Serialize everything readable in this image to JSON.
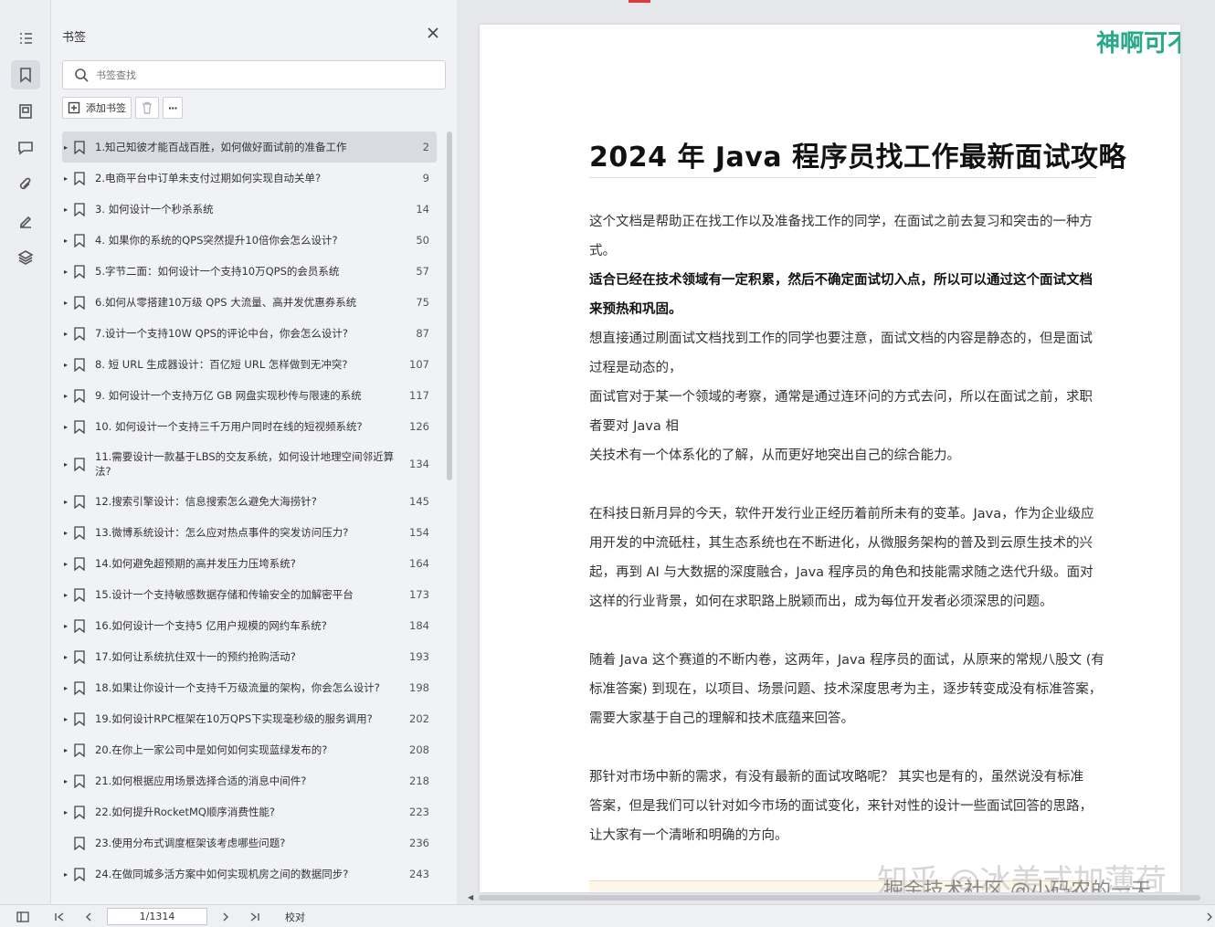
{
  "rail": {
    "icons": [
      "outline-icon",
      "bookmark-icon",
      "thumbnail-icon",
      "comment-icon",
      "attachment-icon",
      "signature-icon",
      "layers-icon"
    ]
  },
  "panel": {
    "title": "书签",
    "search_placeholder": "书签查找",
    "add_bookmark_label": "添加书签",
    "more_label": "···"
  },
  "bookmarks": [
    {
      "text": "1.知己知彼才能百战百胜，如何做好面试前的准备工作",
      "page": "2",
      "expandable": true,
      "selected": true
    },
    {
      "text": "2.电商平台中订单未支付过期如何实现自动关单?",
      "page": "9",
      "expandable": true
    },
    {
      "text": "3. 如何设计一个秒杀系统",
      "page": "14",
      "expandable": true
    },
    {
      "text": "4. 如果你的系统的QPS突然提升10倍你会怎么设计?",
      "page": "50",
      "expandable": true
    },
    {
      "text": "5.字节二面：如何设计一个支持10万QPS的会员系统",
      "page": "57",
      "expandable": true
    },
    {
      "text": "6.如何从零搭建10万级 QPS 大流量、高并发优惠券系统",
      "page": "75",
      "expandable": true
    },
    {
      "text": "7.设计一个支持10W QPS的评论中台，你会怎么设计?",
      "page": "87",
      "expandable": true
    },
    {
      "text": "8. 短 URL 生成器设计：百亿短 URL 怎样做到无冲突?",
      "page": "107",
      "expandable": true
    },
    {
      "text": "9. 如何设计一个支持万亿 GB 网盘实现秒传与限速的系统",
      "page": "117",
      "expandable": true
    },
    {
      "text": "10. 如何设计一个支持三千万用户同时在线的短视频系统?",
      "page": "126",
      "expandable": true
    },
    {
      "text": "11.需要设计一款基于LBS的交友系统，如何设计地理空间邻近算法?",
      "page": "134",
      "expandable": true,
      "twoLine": true
    },
    {
      "text": "12.搜索引擎设计：信息搜索怎么避免大海捞针?",
      "page": "145",
      "expandable": true
    },
    {
      "text": "13.微博系统设计：怎么应对热点事件的突发访问压力?",
      "page": "154",
      "expandable": true
    },
    {
      "text": "14.如何避免超预期的高并发压力压垮系统?",
      "page": "164",
      "expandable": true
    },
    {
      "text": "15.设计一个支持敏感数据存储和传输安全的加解密平台",
      "page": "173",
      "expandable": true
    },
    {
      "text": "16.如何设计一个支持5 亿用户规模的网约车系统?",
      "page": "184",
      "expandable": true
    },
    {
      "text": "17.如何让系统抗住双十一的预约抢购活动?",
      "page": "193",
      "expandable": true
    },
    {
      "text": "18.如果让你设计一个支持千万级流量的架构，你会怎么设计?",
      "page": "198",
      "expandable": true
    },
    {
      "text": "19.如何设计RPC框架在10万QPS下实现毫秒级的服务调用?",
      "page": "202",
      "expandable": true
    },
    {
      "text": "20.在你上一家公司中是如何如何实现蓝绿发布的?",
      "page": "208",
      "expandable": true
    },
    {
      "text": "21.如何根据应用场景选择合适的消息中间件?",
      "page": "218",
      "expandable": true
    },
    {
      "text": "22.如何提升RocketMQ顺序消费性能?",
      "page": "223",
      "expandable": true
    },
    {
      "text": "23.使用分布式调度框架该考虑哪些问题?",
      "page": "236",
      "expandable": false
    },
    {
      "text": "24.在做同城多活方案中如何实现机房之间的数据同步?",
      "page": "243",
      "expandable": true
    }
  ],
  "document": {
    "title": "2024 年 Java 程序员找工作最新面试攻略",
    "paragraphs": [
      {
        "lines": [
          "这个文档是帮助正在找工作以及准备找工作的同学，在面试之前去复习和突击的一种方",
          "式。"
        ],
        "bold": false
      },
      {
        "lines": [
          "适合已经在技术领域有一定积累，然后不确定面试切入点，所以可以通过这个面试文档",
          "来预热和巩固。"
        ],
        "bold": true
      },
      {
        "lines": [
          "想直接通过刷面试文档找到工作的同学也要注意，面试文档的内容是静态的，但是面试",
          "过程是动态的，"
        ],
        "bold": false
      },
      {
        "lines": [
          "面试官对于某一个领域的考察，通常是通过连环问的方式去问，所以在面试之前，求职",
          "者要对 Java 相"
        ],
        "bold": false
      },
      {
        "lines": [
          "关技术有一个体系化的了解，从而更好地突出自己的综合能力。"
        ],
        "bold": false
      },
      {
        "lines": [
          "在科技日新月异的今天，软件开发行业正经历着前所未有的变革。Java，作为企业级应",
          "用开发的中流砥柱，其生态系统也在不断进化，从微服务架构的普及到云原生技术的兴",
          "起，再到 AI 与大数据的深度融合，Java 程序员的角色和技能需求随之迭代升级。面对",
          "这样的行业背景，如何在求职路上脱颖而出，成为每位开发者必须深思的问题。"
        ],
        "bold": false
      },
      {
        "lines": [
          "随着 Java 这个赛道的不断内卷，这两年，Java 程序员的面试，从原来的常规八股文 (有",
          "标准答案) 到现在，以项目、场景问题、技术深度思考为主，逐步转变成没有标准答案，",
          "需要大家基于自己的理解和技术底蕴来回答。"
        ],
        "bold": false
      },
      {
        "lines": [
          "那针对市场中新的需求，有没有最新的面试攻略呢？ 其实也是有的，虽然说没有标准",
          "答案，但是我们可以针对如今市场的面试变化，来针对性的设计一些面试回答的思路，",
          "让大家有一个清晰和明确的方向。"
        ],
        "bold": false
      }
    ],
    "watermark_top": "神啊可不可",
    "watermark_zhihu": "知乎 @冰美式加薄荷",
    "watermark_juejin": "掘金技术社区 @小码农的一天"
  },
  "statusbar": {
    "page_indicator": "1/1314",
    "proofread_label": "校对"
  },
  "colors": {
    "selected_row": "#d8dbe2",
    "watermark_green": "#2aa88a",
    "accent_red": "#e03b3b"
  }
}
